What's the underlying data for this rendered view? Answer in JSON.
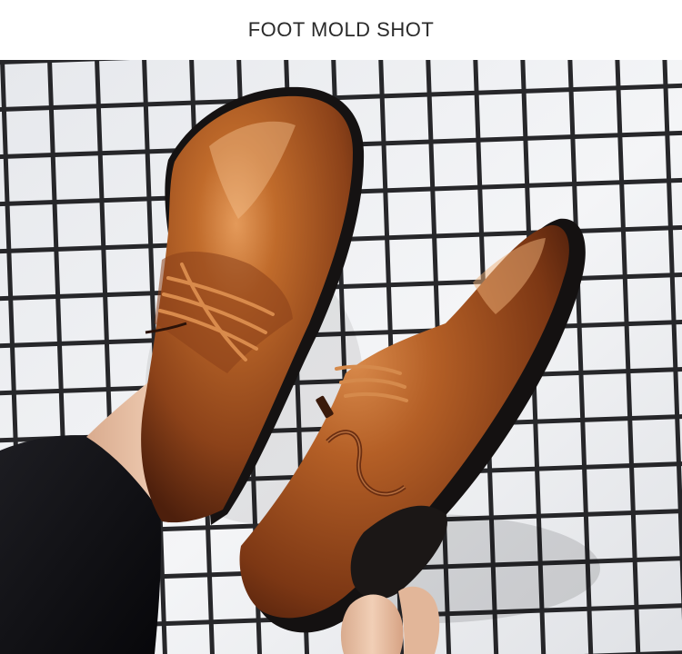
{
  "header": {
    "title": "FOOT MOLD SHOT"
  },
  "photo": {
    "subject": "brown-leather-derby-shoes",
    "colors": {
      "backdrop": "#eef0f2",
      "grid": "#1c1c1f",
      "leather_light": "#c8732f",
      "leather_mid": "#9b4d1e",
      "leather_dark": "#5a2510",
      "sole": "#1a1716",
      "skin": "#e8c3a8",
      "trousers": "#111113"
    }
  }
}
